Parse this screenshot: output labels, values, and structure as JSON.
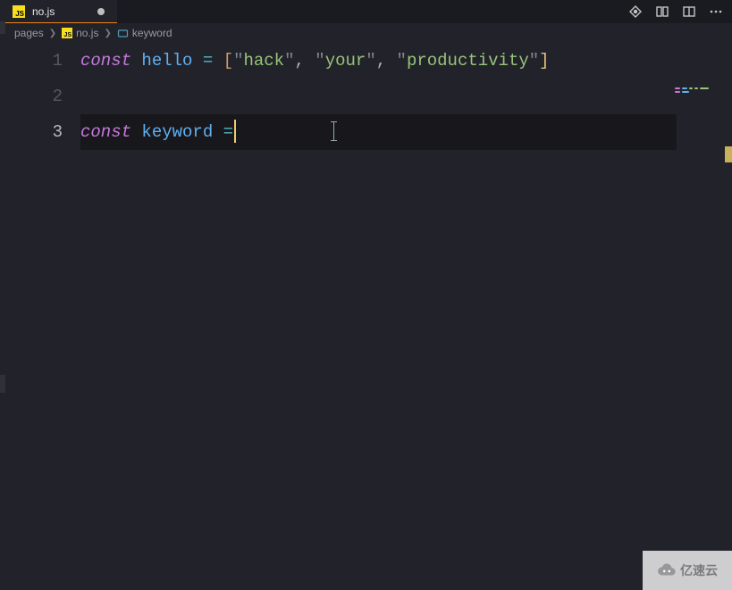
{
  "tab": {
    "filename": "no.js",
    "icon": "js-file-icon",
    "dirty": true
  },
  "toolbar": {
    "icons": [
      "source-control-icon",
      "split-editor-icon",
      "toggle-panel-icon",
      "more-icon"
    ]
  },
  "breadcrumb": {
    "items": [
      {
        "label": "pages",
        "icon": null
      },
      {
        "label": "no.js",
        "icon": "js-file-icon"
      },
      {
        "label": "keyword",
        "icon": "symbol-variable-icon"
      }
    ]
  },
  "editor": {
    "lineNumbers": [
      "1",
      "2",
      "3"
    ],
    "activeLine": 3,
    "tokens": {
      "l1": {
        "const": "const",
        "sp": " ",
        "hello": "hello",
        "eq": "=",
        "lb": "[",
        "q": "\"",
        "s1": "hack",
        "comma": ",",
        "s2": "your",
        "s3": "productivity",
        "rb": "]"
      },
      "l3": {
        "const": "const",
        "sp": " ",
        "keyword": "keyword",
        "eq": "="
      }
    }
  },
  "watermark": {
    "text": "亿速云"
  },
  "colors": {
    "keyword": "#c678dd",
    "variable": "#61afef",
    "operator": "#56b6c2",
    "string": "#98c379",
    "bracket": "#d19a66",
    "accent": "#f08313"
  }
}
